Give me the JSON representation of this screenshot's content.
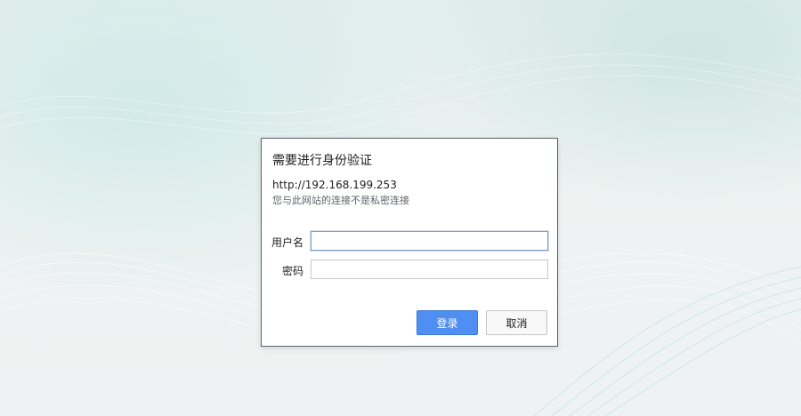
{
  "dialog": {
    "title": "需要进行身份验证",
    "url": "http://192.168.199.253",
    "warning": "您与此网站的连接不是私密连接",
    "username_label": "用户名",
    "username_value": "",
    "password_label": "密码",
    "password_value": "",
    "login_button": "登录",
    "cancel_button": "取消"
  },
  "colors": {
    "login_button_bg": "#4f8ef2",
    "dialog_border": "#5f6367",
    "focused_input_border": "#7a9cc6"
  }
}
